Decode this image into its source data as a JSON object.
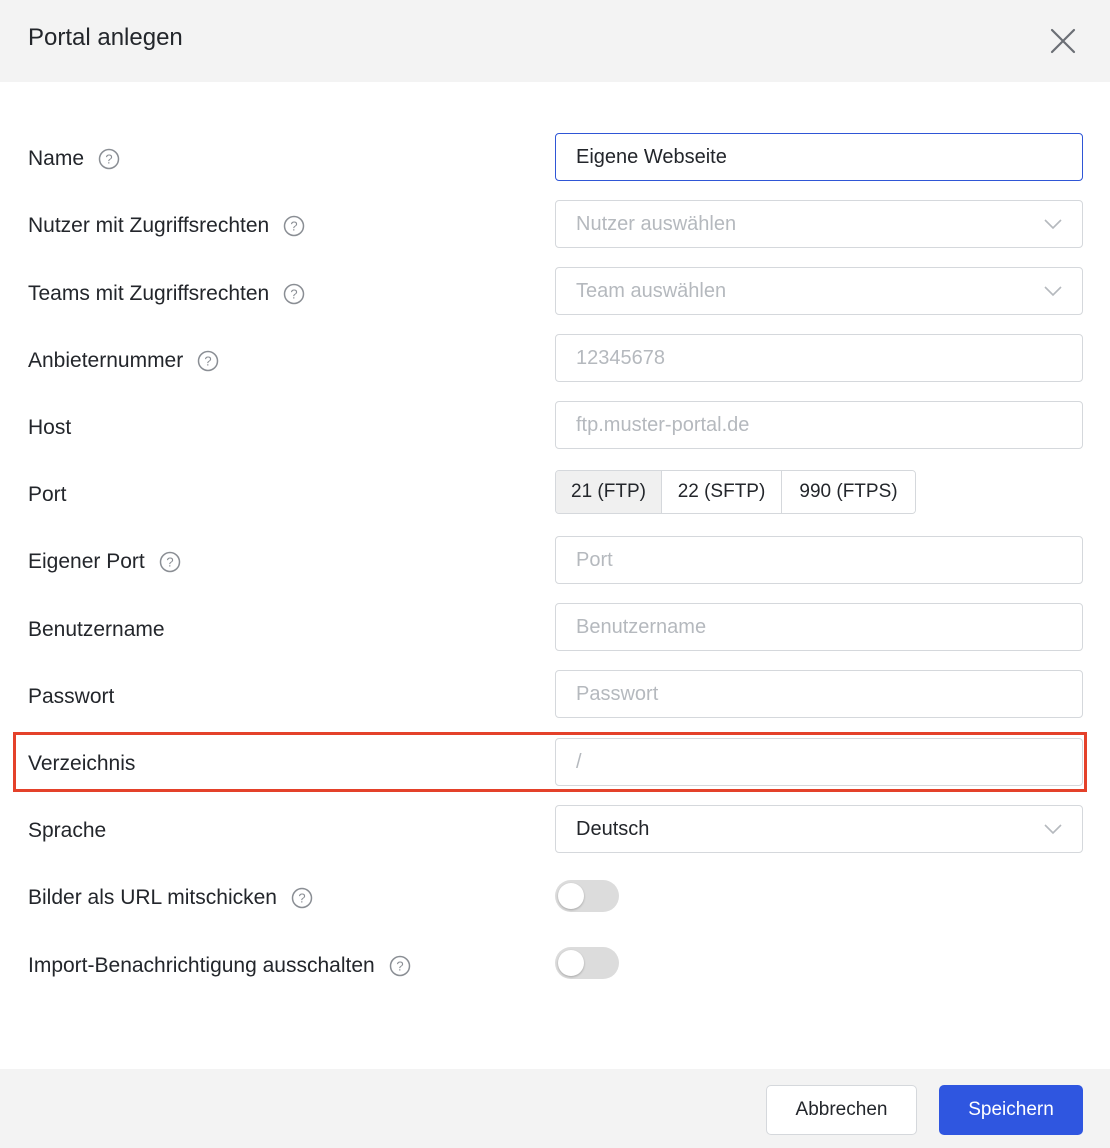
{
  "dialog": {
    "title": "Portal anlegen"
  },
  "form": {
    "name": {
      "label": "Name",
      "value": "Eigene Webseite"
    },
    "users": {
      "label": "Nutzer mit Zugriffsrechten",
      "placeholder": "Nutzer auswählen"
    },
    "teams": {
      "label": "Teams mit Zugriffsrechten",
      "placeholder": "Team auswählen"
    },
    "provider_number": {
      "label": "Anbieternummer",
      "placeholder": "12345678"
    },
    "host": {
      "label": "Host",
      "placeholder": "ftp.muster-portal.de"
    },
    "port": {
      "label": "Port",
      "options": [
        "21 (FTP)",
        "22 (SFTP)",
        "990 (FTPS)"
      ],
      "selected": "21 (FTP)"
    },
    "custom_port": {
      "label": "Eigener Port",
      "placeholder": "Port"
    },
    "username": {
      "label": "Benutzername",
      "placeholder": "Benutzername"
    },
    "password": {
      "label": "Passwort",
      "placeholder": "Passwort"
    },
    "directory": {
      "label": "Verzeichnis",
      "placeholder": "/"
    },
    "language": {
      "label": "Sprache",
      "value": "Deutsch"
    },
    "send_images_as_url": {
      "label": "Bilder als URL mitschicken",
      "enabled": false
    },
    "disable_import_notification": {
      "label": "Import-Benachrichtigung ausschalten",
      "enabled": false
    }
  },
  "footer": {
    "cancel_label": "Abbrechen",
    "save_label": "Speichern"
  },
  "colors": {
    "primary": "#2f56e0",
    "highlight": "#e4412a",
    "header_bg": "#f3f3f3"
  }
}
